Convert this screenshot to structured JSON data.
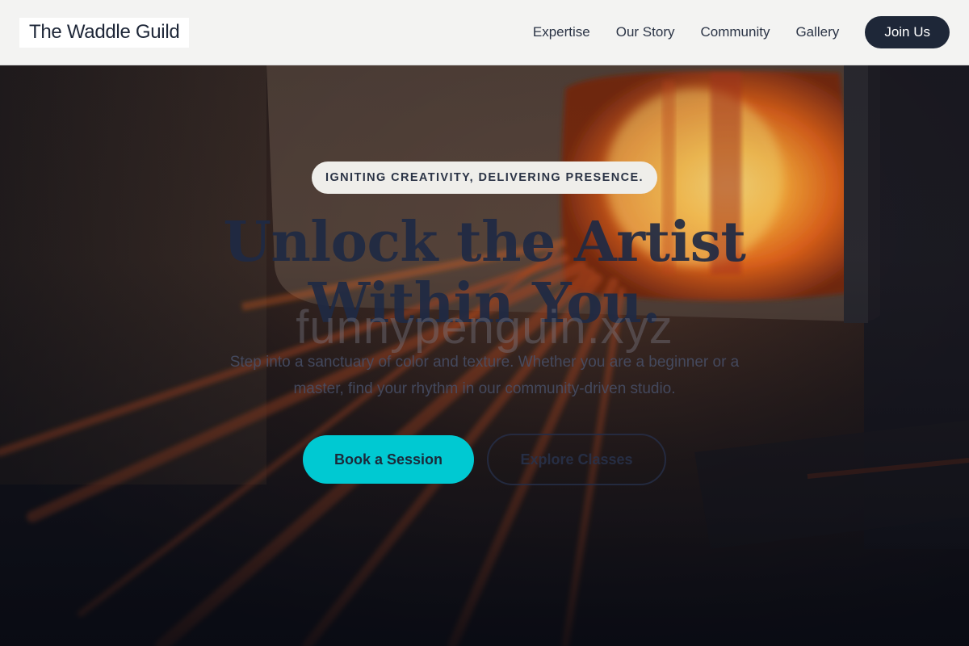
{
  "header": {
    "brand": "The Waddle Guild",
    "nav": [
      {
        "label": "Expertise"
      },
      {
        "label": "Our Story"
      },
      {
        "label": "Community"
      },
      {
        "label": "Gallery"
      }
    ],
    "cta_label": "Join Us"
  },
  "hero": {
    "tagline": "IGNITING CREATIVITY, DELIVERING PRESENCE.",
    "headline": "Unlock the Artist Within You.",
    "watermark": "funnypenguin.xyz",
    "subtext": "Step into a sanctuary of color and texture. Whether you are a beginner or a master, find your rhythm in our community-driven studio.",
    "primary_button": "Book a Session",
    "secondary_button": "Explore Classes"
  },
  "colors": {
    "accent": "#00c9d2",
    "navy": "#1e2738",
    "header_bg": "#f3f3f2",
    "forge_glow": "#ff8a1e"
  }
}
